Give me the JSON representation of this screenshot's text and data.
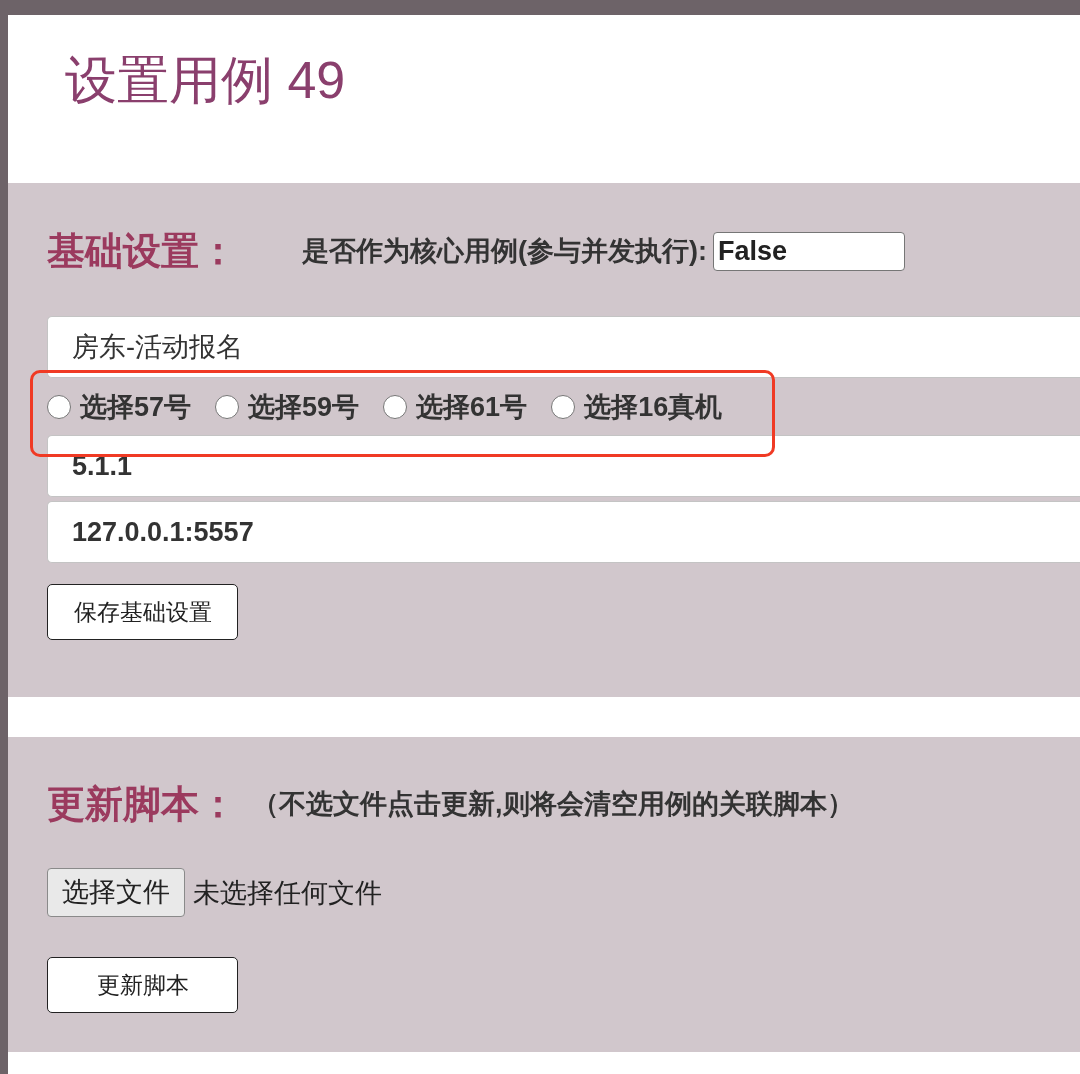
{
  "page": {
    "title": "设置用例 49"
  },
  "basic_settings": {
    "heading": "基础设置：",
    "core_label": "是否作为核心用例(参与并发执行):",
    "core_field": {
      "value": "False"
    },
    "rows": [
      {
        "kind": "field",
        "value": "房东-活动报名",
        "bold": false
      },
      {
        "kind": "radio_group",
        "highlighted": true,
        "options": [
          {
            "label": "选择57号",
            "selected": false
          },
          {
            "label": "选择59号",
            "selected": false
          },
          {
            "label": "选择61号",
            "selected": false
          },
          {
            "label": "选择16真机",
            "selected": false
          }
        ]
      },
      {
        "kind": "field",
        "value": "5.1.1",
        "bold": true
      },
      {
        "kind": "field",
        "value": "127.0.0.1:5557",
        "bold": true
      }
    ],
    "save_button": "保存基础设置"
  },
  "update_script": {
    "heading": "更新脚本：",
    "note": "（不选文件点击更新,则将会清空用例的关联脚本）",
    "file_button": "选择文件",
    "file_status": "未选择任何文件",
    "submit_button": "更新脚本"
  }
}
